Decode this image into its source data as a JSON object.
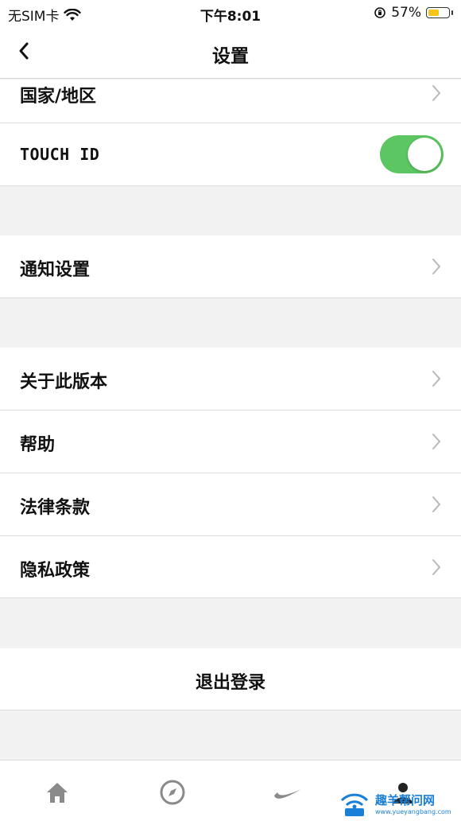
{
  "status_bar": {
    "carrier": "无SIM卡",
    "time": "下午8:01",
    "battery_percent": "57%",
    "battery_level": 0.57
  },
  "nav": {
    "title": "设置"
  },
  "rows": {
    "country_region": "国家/地区",
    "touch_id": "TOUCH ID",
    "touch_id_enabled": true,
    "notification_settings": "通知设置",
    "about_version": "关于此版本",
    "help": "帮助",
    "legal_terms": "法律条款",
    "privacy_policy": "隐私政策",
    "logout": "退出登录"
  },
  "tab_bar": {
    "icons": [
      "home-icon",
      "compass-icon",
      "swoosh-icon",
      "profile-icon"
    ]
  },
  "watermark": {
    "text": "趣羊帮问网",
    "url": "www.yueyangbang.com"
  },
  "colors": {
    "toggle_on": "#5cc662",
    "background": "#f2f2f2",
    "battery_fill": "#f5c518"
  }
}
